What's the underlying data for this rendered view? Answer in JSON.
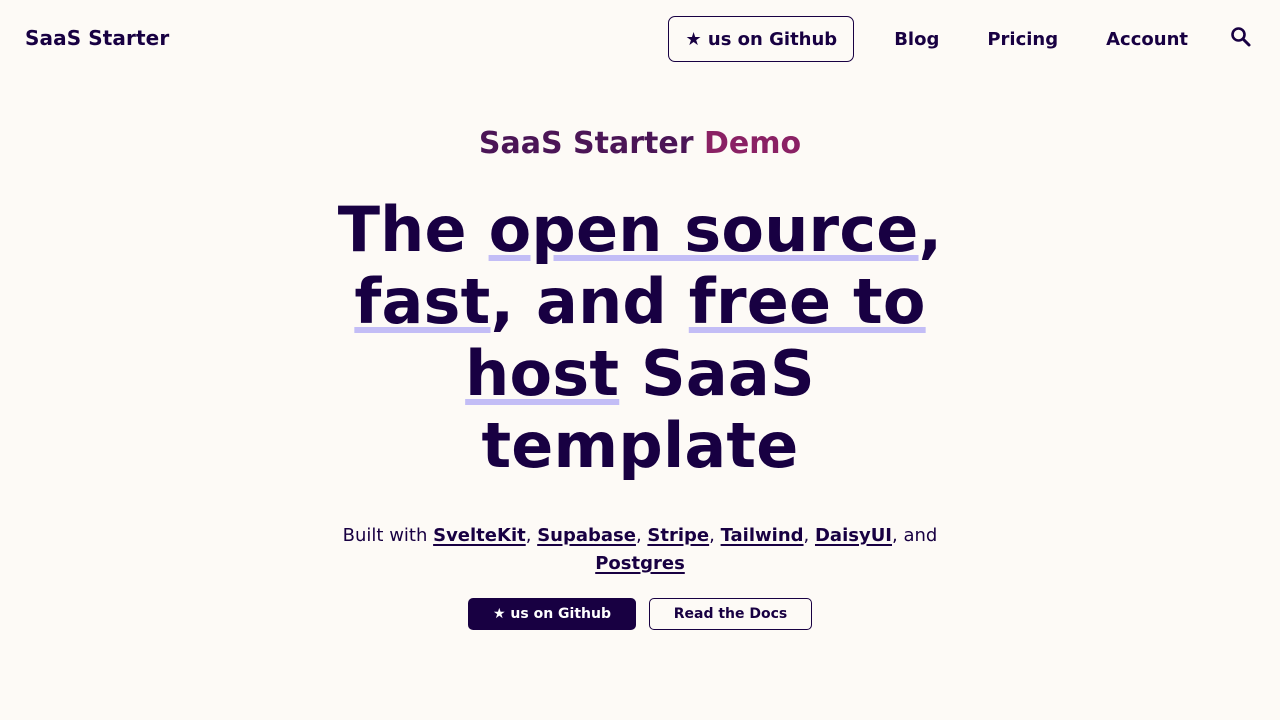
{
  "nav": {
    "brand": "SaaS Starter",
    "github_button": "★ us on Github",
    "links": [
      "Blog",
      "Pricing",
      "Account"
    ],
    "search_icon": "search-icon"
  },
  "hero": {
    "eyebrow_part1": "SaaS Starter ",
    "eyebrow_part2": "Demo",
    "headline": {
      "t1": "The ",
      "h1": "open source",
      "t2": ", ",
      "h2": "fast",
      "t3": ", and ",
      "h3": "free to host",
      "t4": " SaaS template"
    },
    "built": {
      "prefix": "Built with ",
      "techs": [
        "SvelteKit",
        "Supabase",
        "Stripe",
        "Tailwind",
        "DaisyUI",
        "Postgres"
      ],
      "sep": ", ",
      "and": ", and "
    },
    "cta_primary": "★ us on Github",
    "cta_secondary": "Read the Docs"
  },
  "colors": {
    "background": "#fdfaf6",
    "primary": "#180042",
    "eyebrow_1": "#4b1556",
    "eyebrow_2": "#8a2164",
    "highlight_underline": "#c3bdf6"
  }
}
